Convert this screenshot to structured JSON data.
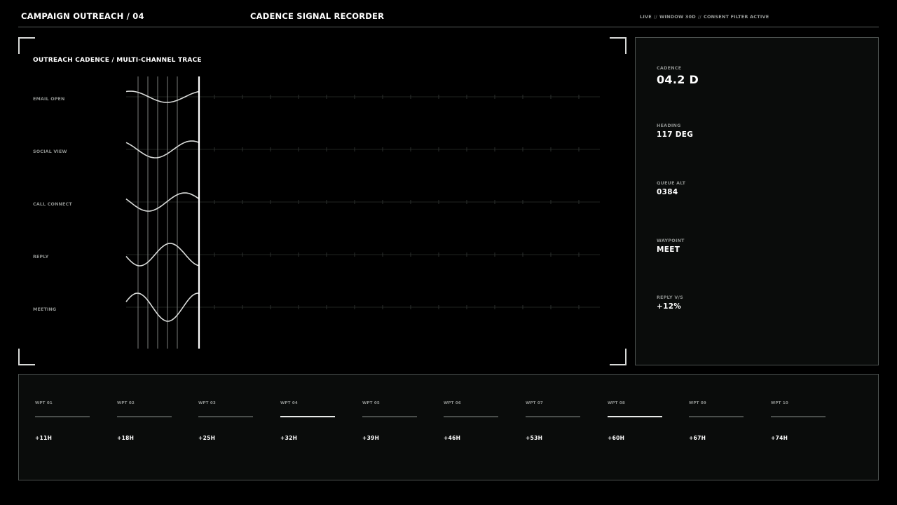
{
  "header": {
    "title": "CAMPAIGN OUTREACH / 04",
    "center_title": "CADENCE SIGNAL RECORDER",
    "status": [
      "LIVE",
      "WINDOW 30D",
      "CONSENT FILTER ACTIVE"
    ],
    "status_separator": "//"
  },
  "trace": {
    "title": "OUTREACH CADENCE / MULTI-CHANNEL TRACE",
    "channels": [
      {
        "label": "EMAIL OPEN"
      },
      {
        "label": "SOCIAL VIEW"
      },
      {
        "label": "CALL CONNECT"
      },
      {
        "label": "REPLY"
      },
      {
        "label": "MEETING"
      }
    ]
  },
  "readout": {
    "cadence": {
      "label": "CADENCE",
      "value": "04.2 D"
    },
    "heading": {
      "label": "HEADING",
      "value": "117 DEG"
    },
    "queue_alt": {
      "label": "QUEUE ALT",
      "value": "0384"
    },
    "waypoint": {
      "label": "WAYPOINT",
      "value": "MEET"
    },
    "reply_vs": {
      "label": "REPLY V/S",
      "value": "+12%"
    }
  },
  "waypoints": [
    {
      "label": "WPT 01",
      "value": "+11H",
      "active": false
    },
    {
      "label": "WPT 02",
      "value": "+18H",
      "active": false
    },
    {
      "label": "WPT 03",
      "value": "+25H",
      "active": false
    },
    {
      "label": "WPT 04",
      "value": "+32H",
      "active": true
    },
    {
      "label": "WPT 05",
      "value": "+39H",
      "active": false
    },
    {
      "label": "WPT 06",
      "value": "+46H",
      "active": false
    },
    {
      "label": "WPT 07",
      "value": "+53H",
      "active": false
    },
    {
      "label": "WPT 08",
      "value": "+60H",
      "active": true
    },
    {
      "label": "WPT 09",
      "value": "+67H",
      "active": false
    },
    {
      "label": "WPT 10",
      "value": "+74H",
      "active": false
    }
  ],
  "colors": {
    "background": "#000000",
    "panel": "#0a0c0b",
    "border": "#4d5250",
    "text": "#ffffff",
    "muted": "#8e918f",
    "active_bar": "#e8eae8"
  }
}
